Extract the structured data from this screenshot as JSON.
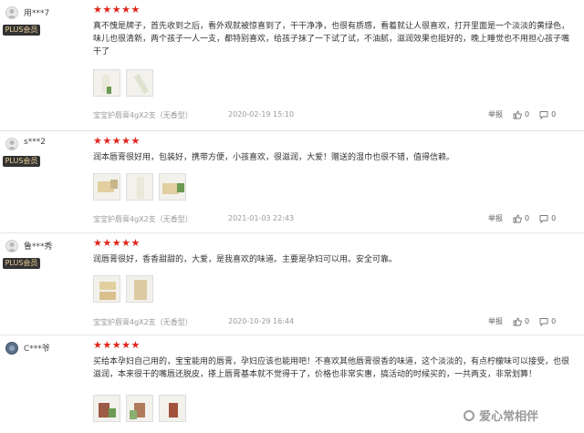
{
  "reviews": [
    {
      "user": "用***7",
      "badge": "PLUS会员",
      "stars": "★★★★★",
      "content": "真不愧是牌子，首先收到之后，看外观就被惊喜到了，干干净净，也很有质感，看着就让人很喜欢，打开里面是一个淡淡的黄绿色，味儿也很清新，两个孩子一人一支，都特别喜欢，给孩子抹了一下试了试，不油腻，滋润效果也挺好的，晚上睡觉也不用担心孩子嘴干了",
      "product": "宝宝护唇膏4gX2支（无香型）",
      "date": "2020-02-19 15:10",
      "report": "举报",
      "likes": "0",
      "comments": "0"
    },
    {
      "user": "s***2",
      "badge": "PLUS会员",
      "stars": "★★★★★",
      "content": "润本唇膏很好用，包装好，携带方便，小孩喜欢，很滋润，大爱！赠送的湿巾也很不错，值得信赖。",
      "product": "宝宝护唇膏4gX2支（无香型）",
      "date": "2021-01-03 22:43",
      "report": "举报",
      "likes": "0",
      "comments": "0"
    },
    {
      "user": "鲁***秀",
      "badge": "PLUS会员",
      "stars": "★★★★★",
      "content": "润唇膏很好，香香甜甜的，大爱，是我喜欢的味道。主要是孕妇可以用。安全可靠。",
      "product": "宝宝护唇膏4gX2支（无香型）",
      "date": "2020-10-29 16:44",
      "report": "举报",
      "likes": "0",
      "comments": "0"
    },
    {
      "user": "C***爷",
      "badge": "",
      "stars": "★★★★★",
      "content": "买给本孕妇自己用的，宝宝能用的唇膏，孕妇应该也能用吧！不喜欢其他唇膏很香的味道，这个淡淡的，有点柠檬味可以接受，也很滋润，本来很干的嘴唇还脱皮，搽上唇膏基本就不觉得干了，价格也非常实惠，搞活动的时候买的，一共两支，非常划算！",
      "product": "",
      "date": "",
      "report": "",
      "likes": "",
      "comments": ""
    }
  ],
  "watermark": "爱心常相伴",
  "icons": {
    "like": "thumbs-up-icon",
    "comment": "chat-bubble-icon",
    "avatar": "user-avatar-icon"
  },
  "colors": {
    "star": "#e1251b",
    "badge_bg": "#333333",
    "badge_text": "#f1d19a",
    "muted": "#999999"
  }
}
